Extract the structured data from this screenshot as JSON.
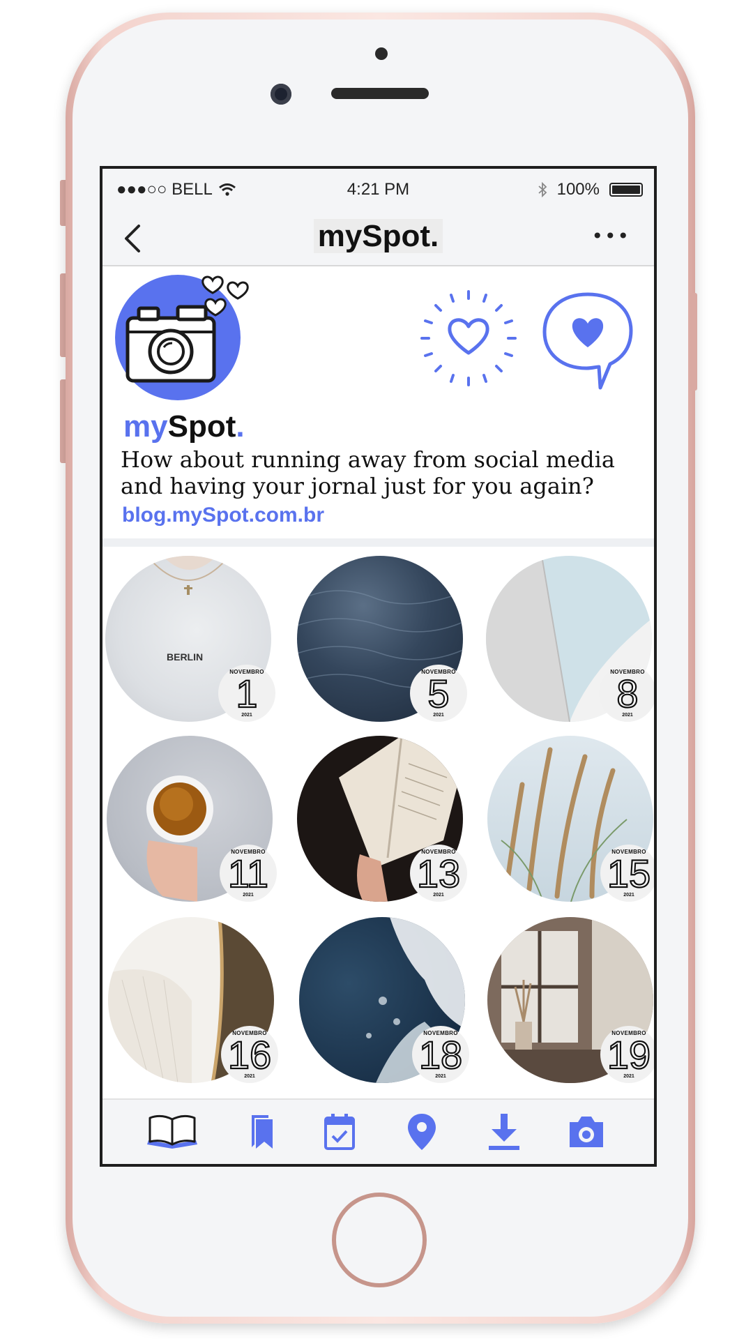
{
  "status_bar": {
    "carrier": "●●●○○ BELL",
    "time": "4:21 PM",
    "battery": "100%",
    "icons": [
      "wifi-icon",
      "bluetooth-icon",
      "battery-icon"
    ]
  },
  "nav": {
    "title": "mySpot.",
    "back_icon": "chevron-left-icon",
    "more_icon": "ellipsis-icon",
    "more_label": "•••"
  },
  "profile": {
    "brand_my": "my",
    "brand_spot": "Spot",
    "brand_dot": ".",
    "bio": "How about running away from social media and having your jornal just for you again?",
    "link": "blog.mySpot.com.br",
    "accent": "#5972ee"
  },
  "posts": [
    {
      "month": "NOVEMBRO",
      "day": "1",
      "year": "2021",
      "image": "white-shirt-berlin"
    },
    {
      "month": "NOVEMBRO",
      "day": "5",
      "year": "2021",
      "image": "dark-water"
    },
    {
      "month": "NOVEMBRO",
      "day": "8",
      "year": "2021",
      "image": "white-architecture-sky"
    },
    {
      "month": "NOVEMBRO",
      "day": "11",
      "year": "2021",
      "image": "hand-holding-tea"
    },
    {
      "month": "NOVEMBRO",
      "day": "13",
      "year": "2021",
      "image": "open-book"
    },
    {
      "month": "NOVEMBRO",
      "day": "15",
      "year": "2021",
      "image": "pampas-grass"
    },
    {
      "month": "NOVEMBRO",
      "day": "16",
      "year": "2021",
      "image": "white-shell-roof"
    },
    {
      "month": "NOVEMBRO",
      "day": "18",
      "year": "2021",
      "image": "ocean-waves"
    },
    {
      "month": "NOVEMBRO",
      "day": "19",
      "year": "2021",
      "image": "window-dried-flowers"
    }
  ],
  "tabbar": [
    "book-icon",
    "bookmark-icon",
    "calendar-icon",
    "location-pin-icon",
    "download-icon",
    "camera-icon"
  ]
}
